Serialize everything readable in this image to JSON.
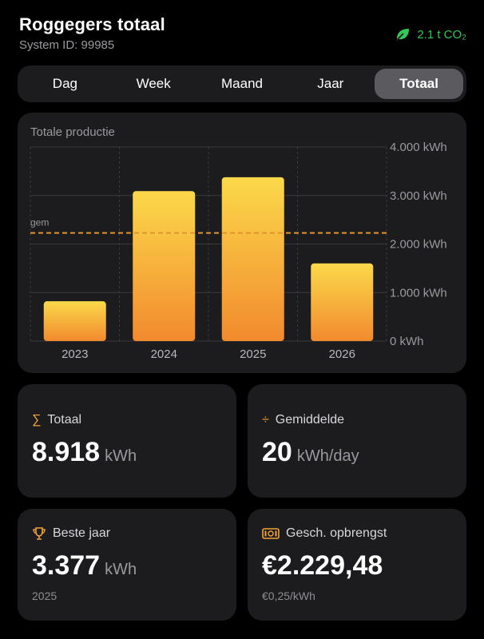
{
  "header": {
    "title": "Roggegers totaal",
    "system_id": "System ID: 99985",
    "co2": "2.1 t CO₂"
  },
  "tabs": [
    {
      "label": "Dag",
      "active": false
    },
    {
      "label": "Week",
      "active": false
    },
    {
      "label": "Maand",
      "active": false
    },
    {
      "label": "Jaar",
      "active": false
    },
    {
      "label": "Totaal",
      "active": true
    }
  ],
  "colors": {
    "accent": "#f2a33a",
    "bar_top": "#fbd94a",
    "bar_bottom": "#f28a2e",
    "avg_line": "#e0952f",
    "co2_green": "#34c759"
  },
  "chart": {
    "title": "Totale productie",
    "avg_label": "gem"
  },
  "chart_data": {
    "type": "bar",
    "categories": [
      "2023",
      "2024",
      "2025",
      "2026"
    ],
    "values": [
      820,
      3090,
      3377,
      1600
    ],
    "average": 2229,
    "ylim": [
      0,
      4000
    ],
    "yticks": [
      0,
      1000,
      2000,
      3000,
      4000
    ],
    "ytick_labels": [
      "0 kWh",
      "1.000 kWh",
      "2.000 kWh",
      "3.000 kWh",
      "4.000 kWh"
    ],
    "grid": true
  },
  "stats": {
    "total": {
      "icon": "sigma-icon",
      "label": "Totaal",
      "value": "8.918",
      "unit": "kWh"
    },
    "average": {
      "icon": "divide-icon",
      "label": "Gemiddelde",
      "value": "20",
      "unit": "kWh/day"
    },
    "best_year": {
      "icon": "trophy-icon",
      "label": "Beste jaar",
      "value": "3.377",
      "unit": "kWh",
      "sub": "2025"
    },
    "revenue": {
      "icon": "banknote-icon",
      "label": "Gesch. opbrengst",
      "value": "€2.229,48",
      "sub": "€0,25/kWh"
    }
  }
}
